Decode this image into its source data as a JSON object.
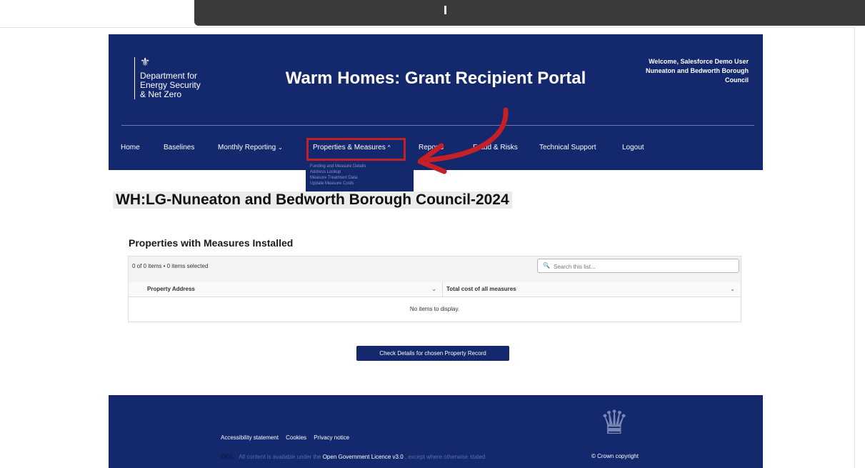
{
  "browser": {
    "tab_indicator": "|"
  },
  "header": {
    "crest_icon": "government-crest-icon",
    "department": "Department for\nEnergy Security\n& Net Zero",
    "title": "Warm Homes: Grant Recipient Portal",
    "welcome": "Welcome, Salesforce Demo User Nuneaton and Bedworth Borough Council"
  },
  "nav": {
    "items": [
      {
        "label": "Home"
      },
      {
        "label": "Baselines"
      },
      {
        "label": "Monthly Reporting",
        "chevron": "⌄"
      },
      {
        "label": "Properties & Measures",
        "chevron": "^"
      },
      {
        "label": "Reports"
      },
      {
        "label": "Fraud & Risks"
      },
      {
        "label": "Technical Support"
      },
      {
        "label": "Logout"
      }
    ],
    "dropdown": [
      "Funding and Measure Details",
      "Address Lookup",
      "Measure Treatment Data",
      "Update Measure Costs"
    ]
  },
  "page": {
    "heading": "WH:LG-Nuneaton and Bedworth Borough Council-2024",
    "section_title": "Properties with Measures Installed"
  },
  "list": {
    "count": "0 of 0 items • 0 items selected",
    "search_placeholder": "Search this list...",
    "columns": [
      "Property Address",
      "Total cost of all measures"
    ],
    "empty": "No items to display."
  },
  "cta": {
    "label": "Check Details for chosen Property Record"
  },
  "footer": {
    "links": [
      "Accessibility statement",
      "Cookies",
      "Privacy notice"
    ],
    "ogl": "OGL",
    "licence_prefix": "All content is available under the",
    "licence_link": "Open Government Licence v3.0",
    "licence_suffix": ", except where otherwise stated",
    "copyright": "© Crown copyright"
  },
  "colors": {
    "brand_navy": "#13286d",
    "highlight_red": "#c62026"
  }
}
